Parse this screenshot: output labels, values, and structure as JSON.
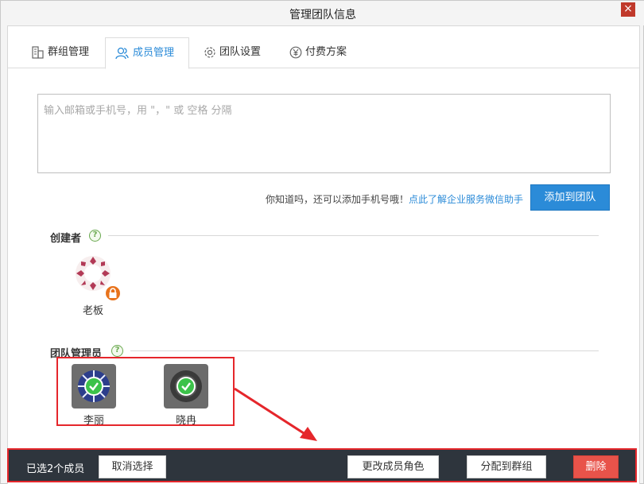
{
  "window": {
    "title": "管理团队信息"
  },
  "tabs": [
    {
      "label": "群组管理",
      "icon": "building-icon"
    },
    {
      "label": "成员管理",
      "icon": "users-icon",
      "active": true
    },
    {
      "label": "团队设置",
      "icon": "gear-icon"
    },
    {
      "label": "付费方案",
      "icon": "yen-icon"
    }
  ],
  "invite": {
    "placeholder": "输入邮箱或手机号，用 \"，\" 或 空格 分隔",
    "value": "",
    "hint_text": "你知道吗，还可以添加手机号哦！",
    "hint_link": "点此了解企业服务微信助手",
    "add_button": "添加到团队"
  },
  "creator_section": {
    "title": "创建者",
    "help": "?",
    "members": [
      {
        "name": "老板",
        "locked": true
      }
    ]
  },
  "admin_section": {
    "title": "团队管理员",
    "help": "?",
    "members": [
      {
        "name": "李丽",
        "selected": true
      },
      {
        "name": "晓冉",
        "selected": true
      }
    ]
  },
  "bottom_bar": {
    "selected_text": "已选2个成员",
    "cancel_label": "取消选择",
    "change_role_label": "更改成员角色",
    "assign_group_label": "分配到群组",
    "delete_label": "删除"
  },
  "colors": {
    "accent": "#2b8bd8",
    "highlight": "#e5262b",
    "bar_bg": "#2e353d",
    "delete": "#e8534a",
    "check": "#3cc24a"
  }
}
